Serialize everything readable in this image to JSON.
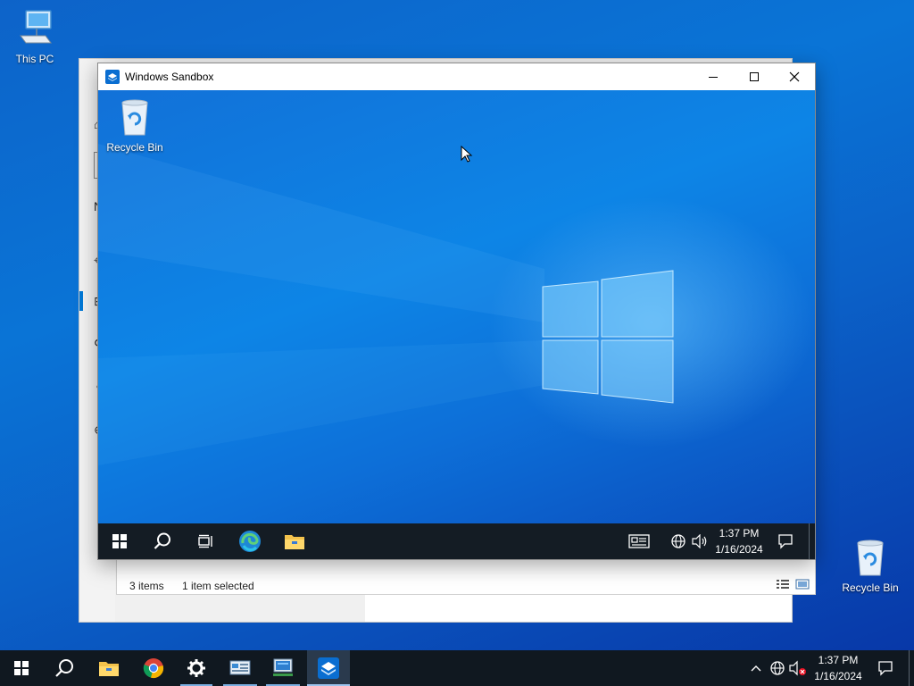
{
  "desktop": {
    "icons": [
      {
        "label": "This PC",
        "icon": "this-pc-icon"
      },
      {
        "label": "Recycle Bin",
        "icon": "recycle-bin-icon"
      }
    ]
  },
  "explorer": {
    "status_items": "3 items",
    "status_selected": "1 item selected"
  },
  "sandbox": {
    "title": "Windows Sandbox",
    "desktop_icon_label": "Recycle Bin",
    "taskbar": {
      "time": "1:37 PM",
      "date": "1/16/2024"
    }
  },
  "taskbar": {
    "time": "1:37 PM",
    "date": "1/16/2024",
    "pinned": [
      "start-icon",
      "search-icon",
      "file-explorer-icon",
      "chrome-icon",
      "settings-icon",
      "control-panel-icon",
      "remote-desktop-icon",
      "windows-sandbox-icon"
    ]
  },
  "colors": {
    "accent": "#0078d7",
    "taskbar": "#101820",
    "desktop": "#0a5fc4"
  }
}
